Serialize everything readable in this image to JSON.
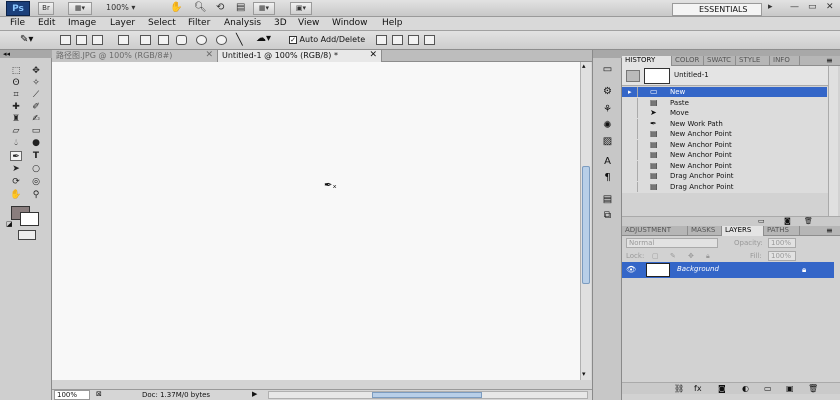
{
  "app": {
    "logo": "Ps",
    "zoom": "100%",
    "workspace": "ESSENTIALS"
  },
  "menu": [
    "File",
    "Edit",
    "Image",
    "Layer",
    "Select",
    "Filter",
    "Analysis",
    "3D",
    "View",
    "Window",
    "Help"
  ],
  "options": {
    "auto_add_delete": "Auto Add/Delete"
  },
  "tabs": [
    {
      "label": "路径图.JPG @ 100% (RGB/8#)",
      "active": false
    },
    {
      "label": "Untitled-1 @ 100% (RGB/8) *",
      "active": true
    }
  ],
  "status": {
    "zoom": "100%",
    "doc": "Doc: 1.37M/0 bytes"
  },
  "history": {
    "tabs": [
      "HISTORY",
      "COLOR",
      "SWATC",
      "STYLE",
      "INFO"
    ],
    "snapshot": "Untitled-1",
    "items": [
      {
        "label": "New",
        "icon": "new-doc-icon",
        "selected": true
      },
      {
        "label": "Paste",
        "icon": "paste-icon",
        "selected": false
      },
      {
        "label": "Move",
        "icon": "move-icon",
        "selected": false
      },
      {
        "label": "New Work Path",
        "icon": "pen-icon",
        "selected": false
      },
      {
        "label": "New Anchor Point",
        "icon": "anchor-icon",
        "selected": false
      },
      {
        "label": "New Anchor Point",
        "icon": "anchor-icon",
        "selected": false
      },
      {
        "label": "New Anchor Point",
        "icon": "anchor-icon",
        "selected": false
      },
      {
        "label": "New Anchor Point",
        "icon": "anchor-icon",
        "selected": false
      },
      {
        "label": "Drag Anchor Point",
        "icon": "anchor-icon",
        "selected": false
      },
      {
        "label": "Drag Anchor Point",
        "icon": "anchor-icon",
        "selected": false
      }
    ]
  },
  "layers": {
    "tabs": [
      "ADJUSTMENT",
      "MASKS",
      "LAYERS",
      "PATHS"
    ],
    "blend_mode": "Normal",
    "opacity_label": "Opacity:",
    "opacity": "100%",
    "lock_label": "Lock:",
    "fill_label": "Fill:",
    "fill": "100%",
    "layer_name": "Background"
  }
}
